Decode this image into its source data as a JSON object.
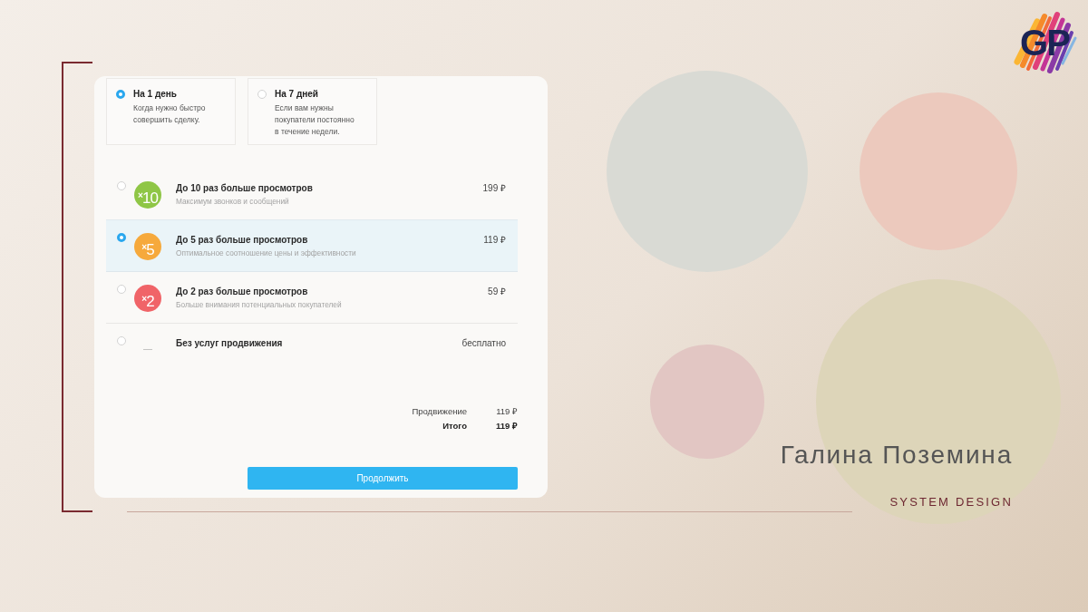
{
  "durations": [
    {
      "title": "На 1 день",
      "description": "Когда нужно быстро совершить сделку.",
      "selected": true
    },
    {
      "title": "На 7 дней",
      "description": "Если вам нужны покупатели постоянно в течение недели.",
      "selected": false
    }
  ],
  "options": [
    {
      "badge": "×10",
      "color": "#8fc646",
      "title": "До 10 раз больше просмотров",
      "subtitle": "Максимум звонков и сообщений",
      "price": "199 ₽",
      "selected": false
    },
    {
      "badge": "×5",
      "color": "#f6a93c",
      "title": "До 5 раз больше просмотров",
      "subtitle": "Оптимальное соотношение цены и эффективности",
      "price": "119 ₽",
      "selected": true
    },
    {
      "badge": "×2",
      "color": "#f06468",
      "title": "До 2 раз больше просмотров",
      "subtitle": "Больше внимания потенциальных покупателей",
      "price": "59 ₽",
      "selected": false
    },
    {
      "badge": "—",
      "title": "Без услуг продвижения",
      "price": "бесплатно",
      "selected": false
    }
  ],
  "summary": [
    {
      "kind": "line",
      "label": "Продвижение",
      "value": "119 ₽"
    },
    {
      "kind": "total",
      "label": "Итого",
      "value": "119 ₽"
    }
  ],
  "button": {
    "label": "Продолжить"
  },
  "logo": {
    "text": "GP"
  },
  "author": {
    "name": "Галина Поземина",
    "role": "SYSTEM DESIGN"
  }
}
